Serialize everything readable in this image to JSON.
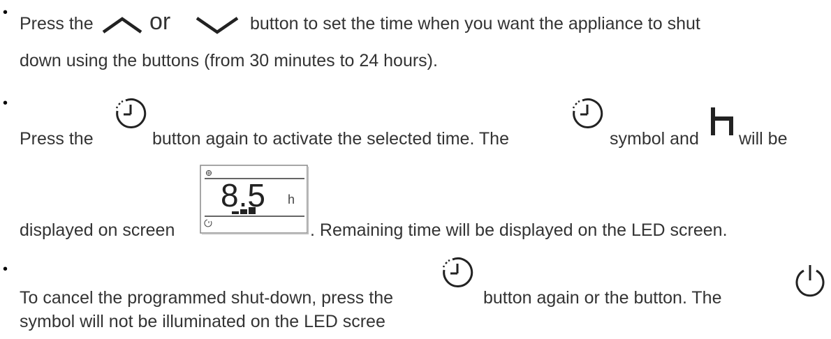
{
  "bullets": [
    "•",
    "•",
    "•"
  ],
  "p1": {
    "line1_a": "Press the",
    "or_word": "or",
    "line1_b": "button to set the time when you want the appliance to shut",
    "line2": "down using the buttons (from 30 minutes to 24 hours)."
  },
  "p2": {
    "line1_a": "Press the",
    "line1_b": "button again to activate the selected time. The",
    "line1_c": "symbol and",
    "line1_d": "will be",
    "line2_a": "displayed on screen",
    "line2_b": ". Remaining time will be displayed on the LED screen.",
    "lcd": {
      "value": "8.5",
      "unit": "h"
    }
  },
  "p3": {
    "line1_a": "To cancel the programmed shut-down, press the",
    "line1_b": "button again or the button. The",
    "line2": "symbol will not be illuminated on the LED scree"
  },
  "icons": {
    "up": "chevron-up-icon",
    "down": "chevron-down-icon",
    "timer": "timer-icon",
    "hour": "hour-h-icon",
    "power": "power-icon",
    "lcd": "lcd-display-icon"
  }
}
